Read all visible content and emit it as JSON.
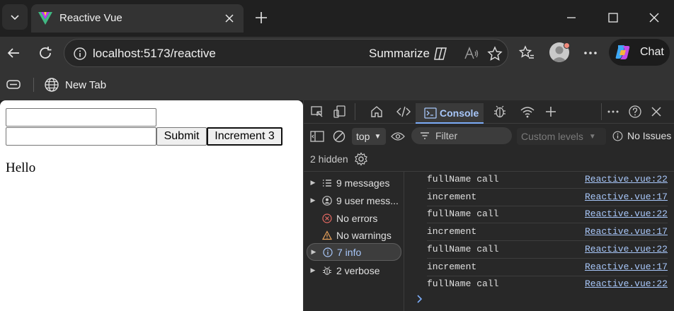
{
  "browser": {
    "tab": {
      "title": "Reactive Vue"
    },
    "address": {
      "url": "localhost:5173/reactive",
      "summarize_label": "Summarize"
    },
    "chat_label": "Chat",
    "favorites": {
      "new_tab_label": "New Tab"
    }
  },
  "page": {
    "inputs": [
      {
        "value": ""
      },
      {
        "value": ""
      }
    ],
    "submit_label": "Submit",
    "increment_label": "Increment 3",
    "greeting": "Hello"
  },
  "devtools": {
    "console_tab_label": "Console",
    "context_select": "top",
    "filter_placeholder": "Filter",
    "levels_label": "Custom levels",
    "issues_label": "No Issues",
    "hidden_label": "2 hidden",
    "sidebar": [
      {
        "label": "9 messages",
        "icon": "list-icon",
        "expandable": true
      },
      {
        "label": "9 user mess...",
        "icon": "user-icon",
        "expandable": true
      },
      {
        "label": "No errors",
        "icon": "error-icon",
        "expandable": false
      },
      {
        "label": "No warnings",
        "icon": "warning-icon",
        "expandable": false
      },
      {
        "label": "7 info",
        "icon": "info-icon",
        "expandable": true,
        "selected": true
      },
      {
        "label": "2 verbose",
        "icon": "bug-icon",
        "expandable": true
      }
    ],
    "logs": [
      {
        "message": "fullName call",
        "source": "Reactive.vue:22"
      },
      {
        "message": "increment",
        "source": "Reactive.vue:17"
      },
      {
        "message": "fullName call",
        "source": "Reactive.vue:22"
      },
      {
        "message": "increment",
        "source": "Reactive.vue:17"
      },
      {
        "message": "fullName call",
        "source": "Reactive.vue:22"
      },
      {
        "message": "increment",
        "source": "Reactive.vue:17"
      },
      {
        "message": "fullName call",
        "source": "Reactive.vue:22"
      }
    ]
  },
  "colors": {
    "accent": "#7cacf8",
    "link": "#a8c7fa",
    "error": "#e46962",
    "warning": "#e9a25b"
  }
}
